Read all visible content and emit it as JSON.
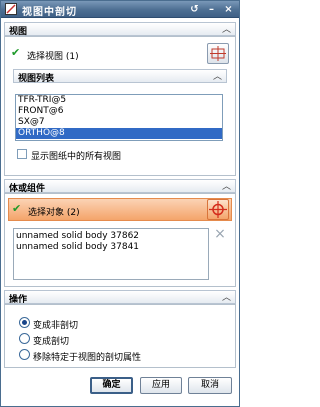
{
  "window": {
    "title": "视图中剖切",
    "reset_icon": "↺",
    "minimize_icon": "–",
    "close_icon": "×"
  },
  "view_section": {
    "header": "视图",
    "select_label": "选择视图 (1)",
    "list_header": "视图列表",
    "views": [
      "TFR-TRI@5",
      "FRONT@6",
      "SX@7",
      "ORTHO@8"
    ],
    "selected_index": 3,
    "show_all_label": "显示图纸中的所有视图",
    "show_all_checked": false
  },
  "body_section": {
    "header": "体或组件",
    "select_label": "选择对象 (2)",
    "bodies": [
      "unnamed solid body 37862",
      "unnamed solid body 37841"
    ],
    "remove_icon": "×"
  },
  "operation_section": {
    "header": "操作",
    "options": [
      "变成非剖切",
      "变成剖切",
      "移除特定于视图的剖切属性"
    ],
    "selected_index": 0
  },
  "buttons": {
    "ok": "确定",
    "apply": "应用",
    "cancel": "取消"
  },
  "colors": {
    "title_bar": "#4e6f93",
    "selection_highlight": "#316ac5",
    "active_select_bg": "#f4a46a",
    "check_green": "#1e9a2a"
  }
}
